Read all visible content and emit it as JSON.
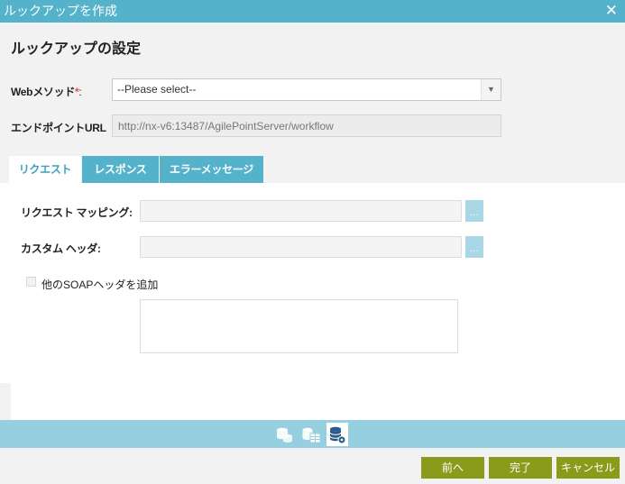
{
  "window": {
    "title": "ルックアップを作成",
    "close_icon": "close-icon"
  },
  "heading": "ルックアップの設定",
  "web_method": {
    "label": "Webメソッド",
    "required_mark": "*",
    "colon": ":",
    "selected": "--Please select--"
  },
  "endpoint": {
    "label": "エンドポイントURL",
    "value": "http://nx-v6:13487/AgilePointServer/workflow"
  },
  "tabs": [
    {
      "label": "リクエスト",
      "active": true
    },
    {
      "label": "レスポンス",
      "active": false
    },
    {
      "label": "エラーメッセージ",
      "active": false
    }
  ],
  "request": {
    "mapping_label": "リクエスト マッピング:",
    "mapping_value": "",
    "header_label": "カスタム ヘッダ:",
    "header_value": "",
    "ellipsis": "...",
    "soap_checkbox_label": "他のSOAPヘッダを追加",
    "soap_checked": false,
    "soap_text": ""
  },
  "steps": [
    {
      "icon": "database-stack-icon",
      "active": false
    },
    {
      "icon": "database-table-icon",
      "active": false
    },
    {
      "icon": "database-settings-icon",
      "active": true
    }
  ],
  "buttons": {
    "back": "前へ",
    "finish": "完了",
    "cancel": "キャンセル"
  },
  "colors": {
    "accent": "#54b2ca",
    "button": "#8a9a1a",
    "step_bar": "#95cfe0",
    "active_tab_text": "#3b9fc0"
  }
}
